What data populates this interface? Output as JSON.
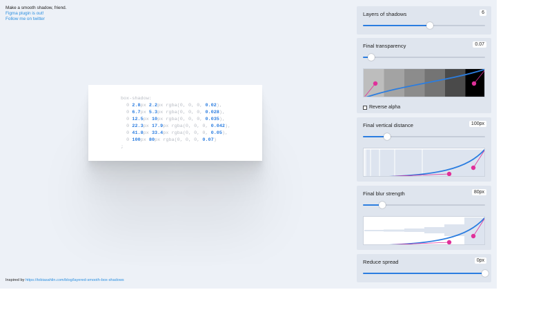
{
  "intro": {
    "lead": "Make a smooth shadow, friend.",
    "figma_link": "Figma plugin is out!",
    "twitter_link": "Follow me on twitter"
  },
  "credit": {
    "prefix": "Inspired by",
    "link": "https://tobiasahlin.com/blog/layered-smooth-box-shadows"
  },
  "code": {
    "open": "box-shadow:",
    "close": ";",
    "layers": [
      {
        "zero": "0",
        "y": "2.8",
        "blur": "2.2",
        "opacity": "0.02",
        "sep": ","
      },
      {
        "zero": "0",
        "y": "6.7",
        "blur": "5.3",
        "opacity": "0.028",
        "sep": ","
      },
      {
        "zero": "0",
        "y": "12.5",
        "blur": "10",
        "opacity": "0.035",
        "sep": ","
      },
      {
        "zero": "0",
        "y": "22.3",
        "blur": "17.9",
        "opacity": "0.042",
        "sep": ","
      },
      {
        "zero": "0",
        "y": "41.8",
        "blur": "33.4",
        "opacity": "0.05",
        "sep": ","
      },
      {
        "zero": "0",
        "y": "100",
        "blur": "80",
        "opacity": "0.07",
        "sep": ""
      }
    ]
  },
  "controls": {
    "layers": {
      "title": "Layers of shadows",
      "value": "6",
      "slider_fraction": 0.55
    },
    "transparency": {
      "title": "Final transparency",
      "value": "0.07",
      "slider_fraction": 0.07,
      "reverse_alpha_label": "Reverse alpha",
      "reverse_alpha_checked": false
    },
    "distance": {
      "title": "Final vertical distance",
      "value": "100px",
      "slider_fraction": 0.2
    },
    "blur": {
      "title": "Final blur strength",
      "value": "80px",
      "slider_fraction": 0.16
    },
    "spread": {
      "title": "Reduce spread",
      "value": "0px",
      "slider_fraction": 1.0
    }
  },
  "colors": {
    "accent": "#2b7de0",
    "curve_handle": "#e0309a",
    "panel_bg": "#dfe5ee",
    "app_bg": "#edf1f7"
  },
  "transparency_swatches": [
    "#bdbdbd",
    "#a3a3a3",
    "#8c8c8c",
    "#747474",
    "#4a4a4a",
    "#000000"
  ]
}
